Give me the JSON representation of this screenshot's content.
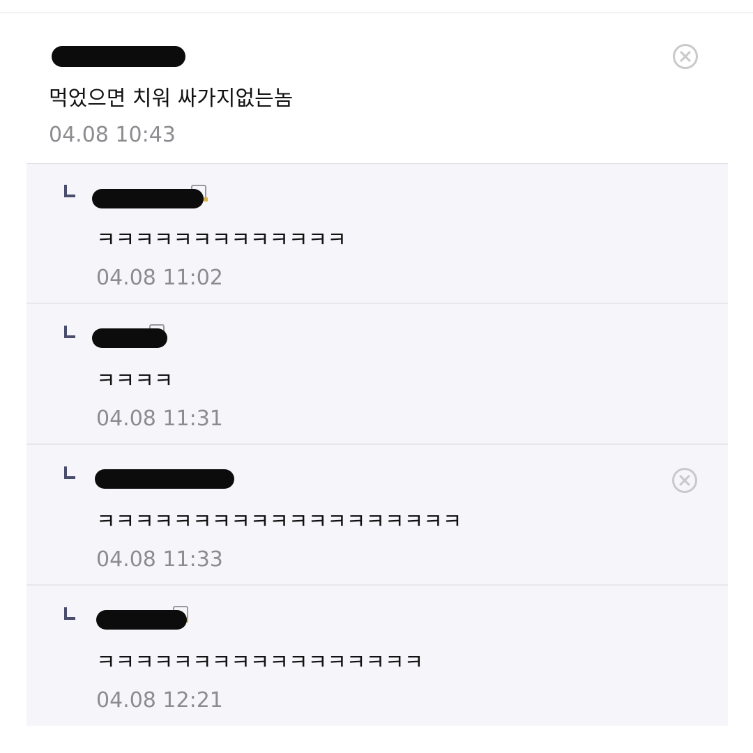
{
  "comment": {
    "text": "먹었으면 치워 싸가지없는놈",
    "time": "04.08 10:43",
    "delete_icon": "close-circle-icon"
  },
  "replies": [
    {
      "text": "ㅋㅋㅋㅋㅋㅋㅋㅋㅋㅋㅋㅋㅋ",
      "time": "04.08 11:02",
      "reply_icon": "reply-arrow-icon"
    },
    {
      "text": "ㅋㅋㅋㅋ",
      "time": "04.08 11:31",
      "reply_icon": "reply-arrow-icon"
    },
    {
      "text": "ㅋㅋㅋㅋㅋㅋㅋㅋㅋㅋㅋㅋㅋㅋㅋㅋㅋㅋㅋ",
      "time": "04.08 11:33",
      "reply_icon": "reply-arrow-icon",
      "delete_icon": "close-circle-icon"
    },
    {
      "text": "ㅋㅋㅋㅋㅋㅋㅋㅋㅋㅋㅋㅋㅋㅋㅋㅋㅋ",
      "time": "04.08 12:21",
      "reply_icon": "reply-arrow-icon"
    }
  ],
  "colors": {
    "text": "#111111",
    "timestamp": "#8c8c90",
    "reply_background": "#f6f6fa",
    "reply_arrow": "#4a4e6c",
    "delete_icon": "#c9c9cc",
    "redaction": "#0c0c0c"
  }
}
